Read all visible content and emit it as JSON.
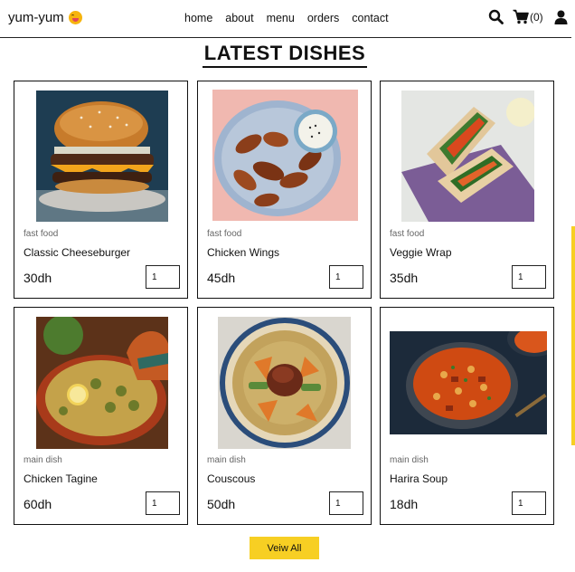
{
  "header": {
    "logo_text": "yum-yum",
    "nav": [
      "home",
      "about",
      "menu",
      "orders",
      "contact"
    ],
    "cart_count": "(0)"
  },
  "main": {
    "title": "LATEST DISHES",
    "view_all_label": "Veiw All",
    "dishes": [
      {
        "category": "fast food",
        "name": "Classic Cheeseburger",
        "price": "30dh",
        "qty": "1",
        "image": "burger-image"
      },
      {
        "category": "fast food",
        "name": "Chicken Wings",
        "price": "45dh",
        "qty": "1",
        "image": "chicken-wings-image"
      },
      {
        "category": "fast food",
        "name": "Veggie Wrap",
        "price": "35dh",
        "qty": "1",
        "image": "veggie-wrap-image"
      },
      {
        "category": "main dish",
        "name": "Chicken Tagine",
        "price": "60dh",
        "qty": "1",
        "image": "tagine-image"
      },
      {
        "category": "main dish",
        "name": "Couscous",
        "price": "50dh",
        "qty": "1",
        "image": "couscous-image"
      },
      {
        "category": "main dish",
        "name": "Harira Soup",
        "price": "18dh",
        "qty": "1",
        "image": "harira-image"
      }
    ]
  },
  "colors": {
    "accent": "#f7cf23",
    "border": "#111111",
    "muted_text": "#666666"
  },
  "icons": [
    "smiley-face-icon",
    "search-icon",
    "cart-icon",
    "user-icon"
  ]
}
